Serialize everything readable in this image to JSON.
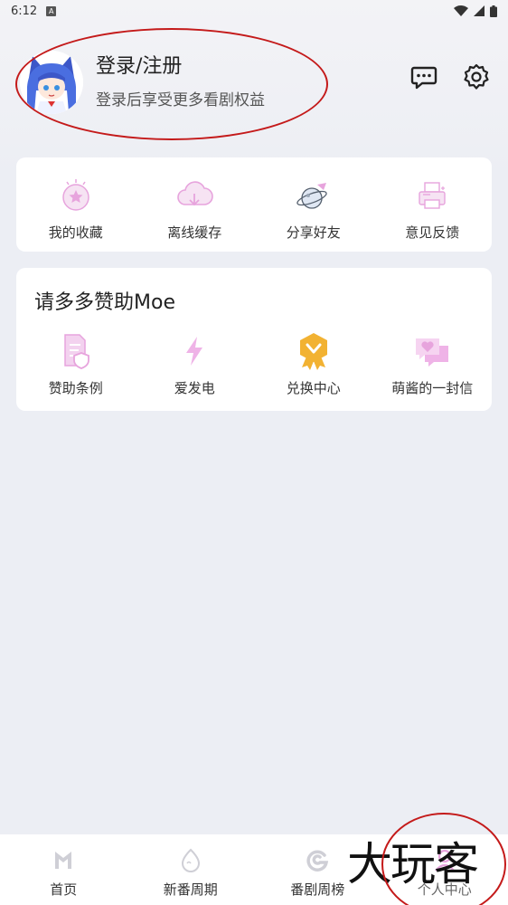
{
  "status_bar": {
    "time": "6:12",
    "badge": "A"
  },
  "profile": {
    "title": "登录/注册",
    "subtitle": "登录后享受更多看剧权益"
  },
  "quick_actions": [
    {
      "label": "我的收藏",
      "icon": "favorite-star-icon"
    },
    {
      "label": "离线缓存",
      "icon": "cloud-download-icon"
    },
    {
      "label": "分享好友",
      "icon": "share-planet-icon"
    },
    {
      "label": "意见反馈",
      "icon": "feedback-printer-icon"
    }
  ],
  "sponsor": {
    "title": "请多多赞助Moe",
    "items": [
      {
        "label": "赞助条例",
        "icon": "document-shield-icon"
      },
      {
        "label": "爱发电",
        "icon": "lightning-icon"
      },
      {
        "label": "兑换中心",
        "icon": "medal-icon"
      },
      {
        "label": "萌酱的一封信",
        "icon": "heart-message-icon"
      }
    ]
  },
  "bottom_nav": [
    {
      "label": "首页",
      "icon": "home-m-icon"
    },
    {
      "label": "新番周期",
      "icon": "egg-icon"
    },
    {
      "label": "番剧周榜",
      "icon": "swirl-icon"
    },
    {
      "label": "个人中心",
      "icon": "person-icon"
    }
  ],
  "watermark": "大玩客",
  "colors": {
    "accent": "#e7a4dd",
    "gold": "#f2b232",
    "annotation_red": "#c41a1a",
    "background": "#eceef4"
  }
}
